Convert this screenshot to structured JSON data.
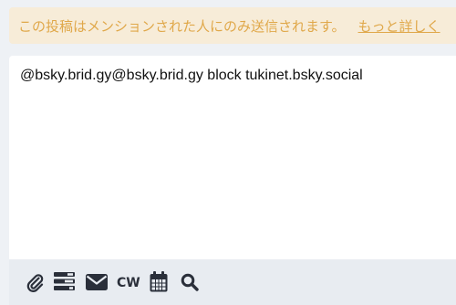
{
  "notice": {
    "text": "この投稿はメンションされた人にのみ送信されます。",
    "link_label": "もっと詳しく"
  },
  "compose": {
    "value": "@bsky.brid.gy@bsky.brid.gy block tukinet.bsky.social"
  },
  "toolbar": {
    "attach_icon": "paperclip-icon",
    "poll_icon": "poll-icon",
    "visibility_icon": "envelope-icon",
    "cw_label": "CW",
    "schedule_icon": "calendar-icon",
    "search_icon": "search-icon"
  },
  "colors": {
    "background": "#eef1f5",
    "notice_bg": "#f7ecd8",
    "notice_text": "#e0a84a",
    "toolbar_bg": "#e8ecf1",
    "icon": "#2a2f3a"
  }
}
